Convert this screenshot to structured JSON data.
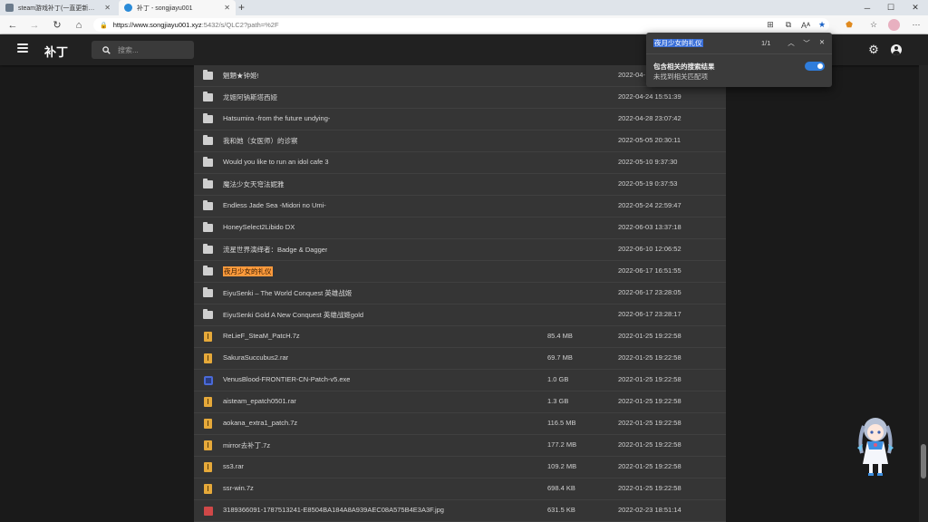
{
  "browser": {
    "tabs": [
      {
        "title": "steam游戏补丁(一直更新中) - sc",
        "active": false
      },
      {
        "title": "补丁 - songjiayu001",
        "active": true
      }
    ],
    "url_host": "https://www.songjiayu001.xyz",
    "url_rest": ":5432/s/QLC2?path=%2F"
  },
  "app": {
    "title": "补丁",
    "search_placeholder": "搜索..."
  },
  "find": {
    "query": "夜月少女的礼仪",
    "count": "1/1",
    "option_title": "包含相关的搜索结果",
    "option_subtitle": "未找到相关匹配项",
    "option_enabled": true
  },
  "files": [
    {
      "type": "folder",
      "name": "魍魉★钟姬!",
      "size": "",
      "date": "2022-04-"
    },
    {
      "type": "folder",
      "name": "龙姬阿钠斯塔西娅",
      "size": "",
      "date": "2022-04-24 15:51:39"
    },
    {
      "type": "folder",
      "name": "Hatsumira -from the future undying-",
      "size": "",
      "date": "2022-04-28 23:07:42"
    },
    {
      "type": "folder",
      "name": "我和她（女医师）的诊察",
      "size": "",
      "date": "2022-05-05 20:30:11"
    },
    {
      "type": "folder",
      "name": "Would you like to run an idol cafe 3",
      "size": "",
      "date": "2022-05-10 9:37:30"
    },
    {
      "type": "folder",
      "name": "魔法少女天穹法妮雅",
      "size": "",
      "date": "2022-05-19 0:37:53"
    },
    {
      "type": "folder",
      "name": "Endless Jade Sea -Midori no Umi-",
      "size": "",
      "date": "2022-05-24 22:59:47"
    },
    {
      "type": "folder",
      "name": "HoneySelect2Libido DX",
      "size": "",
      "date": "2022-06-03 13:37:18"
    },
    {
      "type": "folder",
      "name": "流星世界演绎者：Badge & Dagger",
      "size": "",
      "date": "2022-06-10 12:06:52"
    },
    {
      "type": "folder",
      "name": "夜月少女的礼仪",
      "size": "",
      "date": "2022-06-17 16:51:55",
      "highlight": true
    },
    {
      "type": "folder",
      "name": "EiyuSenki – The World Conquest 英雄战姬",
      "size": "",
      "date": "2022-06-17 23:28:05"
    },
    {
      "type": "folder",
      "name": "EiyuSenki Gold A New Conquest 英雄战姬gold",
      "size": "",
      "date": "2022-06-17 23:28:17"
    },
    {
      "type": "archive",
      "name": "ReLieF_SteaM_PatcH.7z",
      "size": "85.4 MB",
      "date": "2022-01-25 19:22:58"
    },
    {
      "type": "archive",
      "name": "SakuraSuccubus2.rar",
      "size": "69.7 MB",
      "date": "2022-01-25 19:22:58"
    },
    {
      "type": "exe",
      "name": "VenusBlood-FRONTIER-CN-Patch-v5.exe",
      "size": "1.0 GB",
      "date": "2022-01-25 19:22:58"
    },
    {
      "type": "archive",
      "name": "aisteam_epatch0501.rar",
      "size": "1.3 GB",
      "date": "2022-01-25 19:22:58"
    },
    {
      "type": "archive",
      "name": "aokana_extra1_patch.7z",
      "size": "116.5 MB",
      "date": "2022-01-25 19:22:58"
    },
    {
      "type": "archive",
      "name": "mirror去补丁.7z",
      "size": "177.2 MB",
      "date": "2022-01-25 19:22:58"
    },
    {
      "type": "archive",
      "name": "ss3.rar",
      "size": "109.2 MB",
      "date": "2022-01-25 19:22:58"
    },
    {
      "type": "archive",
      "name": "ssr-win.7z",
      "size": "698.4 KB",
      "date": "2022-01-25 19:22:58"
    },
    {
      "type": "image",
      "name": "3189366091-1787513241-E8504BA184A8A939AEC08A575B4E3A3F.jpg",
      "size": "631.5 KB",
      "date": "2022-02-23 18:51:14"
    }
  ]
}
